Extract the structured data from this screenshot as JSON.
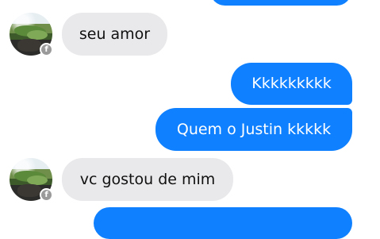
{
  "colors": {
    "incoming_bg": "#e9e9eb",
    "incoming_text": "#111111",
    "outgoing_bg": "#0f80ff",
    "outgoing_text": "#ffffff",
    "badge": "#9a9a9a"
  },
  "messages": [
    {
      "side": "outgoing",
      "text": ""
    },
    {
      "side": "incoming",
      "text": "seu amor",
      "avatar_badge": "f"
    },
    {
      "side": "outgoing",
      "text": "Kkkkkkkkk"
    },
    {
      "side": "outgoing",
      "text": "Quem o Justin kkkkk"
    },
    {
      "side": "incoming",
      "text": "vc gostou de mim",
      "avatar_badge": "f"
    },
    {
      "side": "outgoing",
      "text": ""
    }
  ]
}
